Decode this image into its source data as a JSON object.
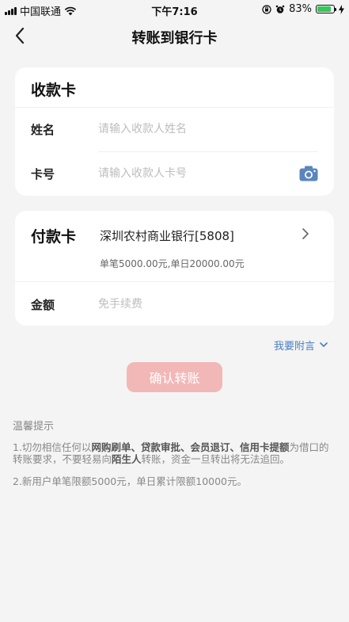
{
  "status_bar": {
    "carrier": "中国联通",
    "time": "下午7:16",
    "battery_percent": "83%",
    "battery_level": 0.83
  },
  "nav": {
    "title": "转账到银行卡"
  },
  "receive_card": {
    "header": "收款卡",
    "name_label": "姓名",
    "name_placeholder": "请输入收款人姓名",
    "card_label": "卡号",
    "card_placeholder": "请输入收款人卡号"
  },
  "pay_card": {
    "header": "付款卡",
    "bank_name": "深圳农村商业银行[5808]",
    "limit_text": "单笔5000.00元,单日20000.00元",
    "amount_label": "金额",
    "amount_placeholder": "免手续费"
  },
  "remark_link": "我要附言",
  "confirm_button": "确认转账",
  "tips": {
    "title": "温馨提示",
    "tip1": {
      "part1": "1.切勿相信任何以",
      "bold1": "网购刷单、贷款审批、会员退订、信用卡提额",
      "part2": "为借口的转账要求，不要轻易向",
      "bold2": "陌生人",
      "part3": "转账，资金一旦转出将无法追回。"
    },
    "tip2": "2.新用户单笔限额5000元，单日累计限额10000元。"
  },
  "colors": {
    "accent_link": "#4a7fc1",
    "confirm_disabled": "#f2b7b7",
    "battery_green": "#34c759"
  }
}
